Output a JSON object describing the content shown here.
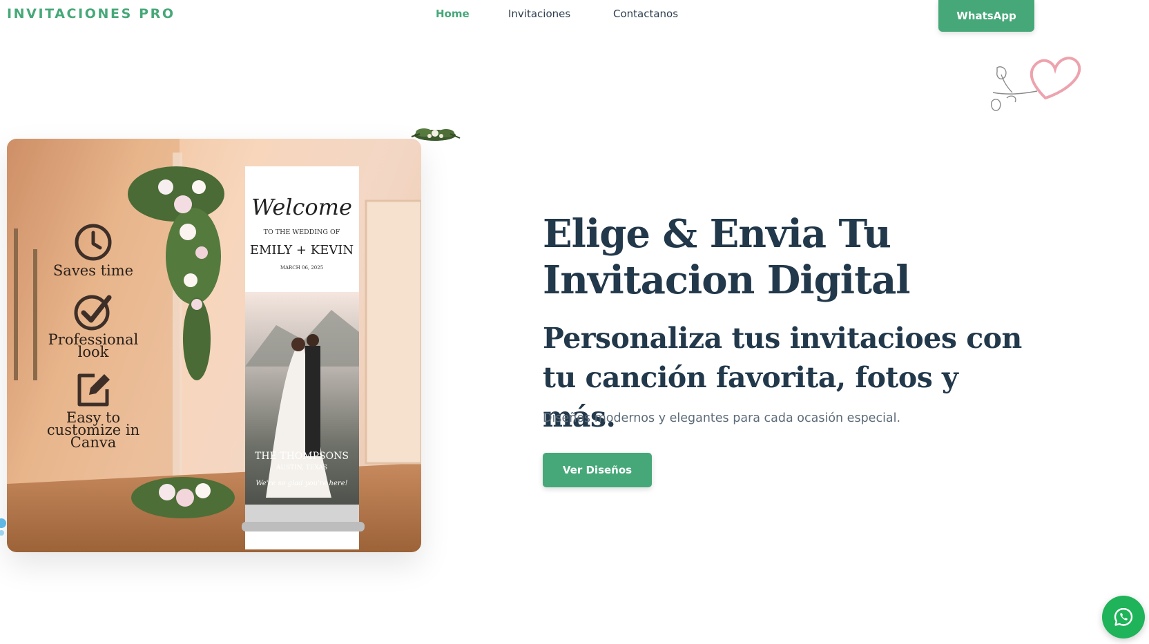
{
  "nav": {
    "brand": "INVITACIONES PRO",
    "links": [
      "Home",
      "Invitaciones",
      "Contactanos"
    ],
    "whatsapp_label": "WhatsApp"
  },
  "hero_image": {
    "features": [
      "Saves time",
      "Professional look",
      "Easy to customize in Canva"
    ],
    "banner": {
      "welcome": "Welcome",
      "to_the_wedding": "TO THE WEDDING OF",
      "names": "EMILY + KEVIN",
      "date": "MARCH 06, 2025",
      "family": "THE THOMPSONS",
      "location": "AUSTIN, TEXAS",
      "closing": "We're so glad you're here!"
    }
  },
  "hero": {
    "title": "Elige & Envia Tu Invitacion Digital",
    "subtitle": "Personaliza tus invitacioes con tu canción favorita, fotos y más.",
    "description": "Diseños modernos y elegantes para cada ocasión especial.",
    "cta_label": "Ver Diseños"
  },
  "colors": {
    "accent": "#46a878",
    "heading": "#22384b",
    "whatsapp_float": "#1fb35a"
  },
  "icons": [
    "heart-flower-icon",
    "clock-icon",
    "check-circle-icon",
    "edit-icon",
    "whatsapp-icon"
  ]
}
